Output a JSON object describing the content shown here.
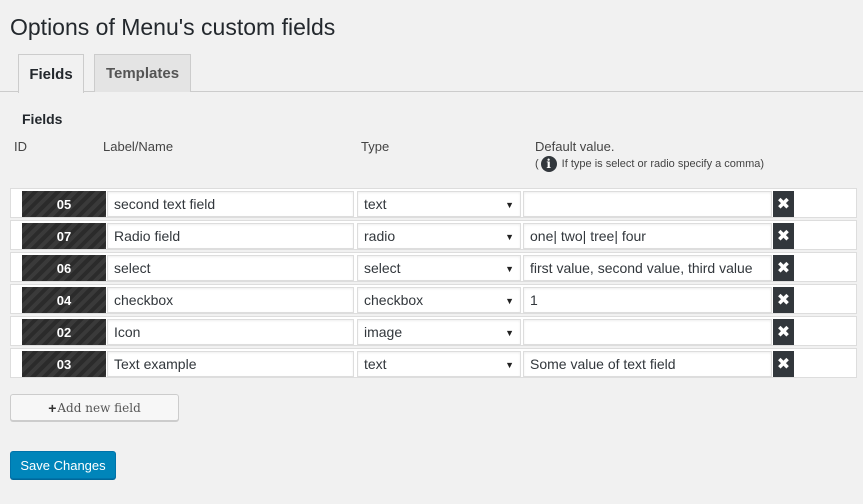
{
  "page": {
    "title": "Options of Menu's custom fields"
  },
  "tabs": [
    {
      "label": "Fields",
      "active": true
    },
    {
      "label": "Templates",
      "active": false
    }
  ],
  "section": {
    "title": "Fields"
  },
  "columns": {
    "id": "ID",
    "label": "Label/Name",
    "type": "Type",
    "default": "Default value.",
    "hint_open": "(",
    "hint": "If type is select or radio specify a comma)"
  },
  "rows": [
    {
      "id": "05",
      "name": "second text field",
      "type": "text",
      "default": ""
    },
    {
      "id": "07",
      "name": "Radio field",
      "type": "radio",
      "default": "one| two| tree| four"
    },
    {
      "id": "06",
      "name": "select",
      "type": "select",
      "default": "first value, second value, third value"
    },
    {
      "id": "04",
      "name": "checkbox",
      "type": "checkbox",
      "default": "1"
    },
    {
      "id": "02",
      "name": "Icon",
      "type": "image",
      "default": ""
    },
    {
      "id": "03",
      "name": "Text example",
      "type": "text",
      "default": "Some value of text field"
    }
  ],
  "icons": {
    "info": "i",
    "remove": "✖",
    "dropdown": "▼",
    "plus": "+"
  },
  "buttons": {
    "add_field": "Add new field",
    "save": "Save Changes"
  },
  "colors": {
    "primary": "#0085ba",
    "id_badge": "#2b2b2b",
    "remove_button": "#32373c"
  }
}
